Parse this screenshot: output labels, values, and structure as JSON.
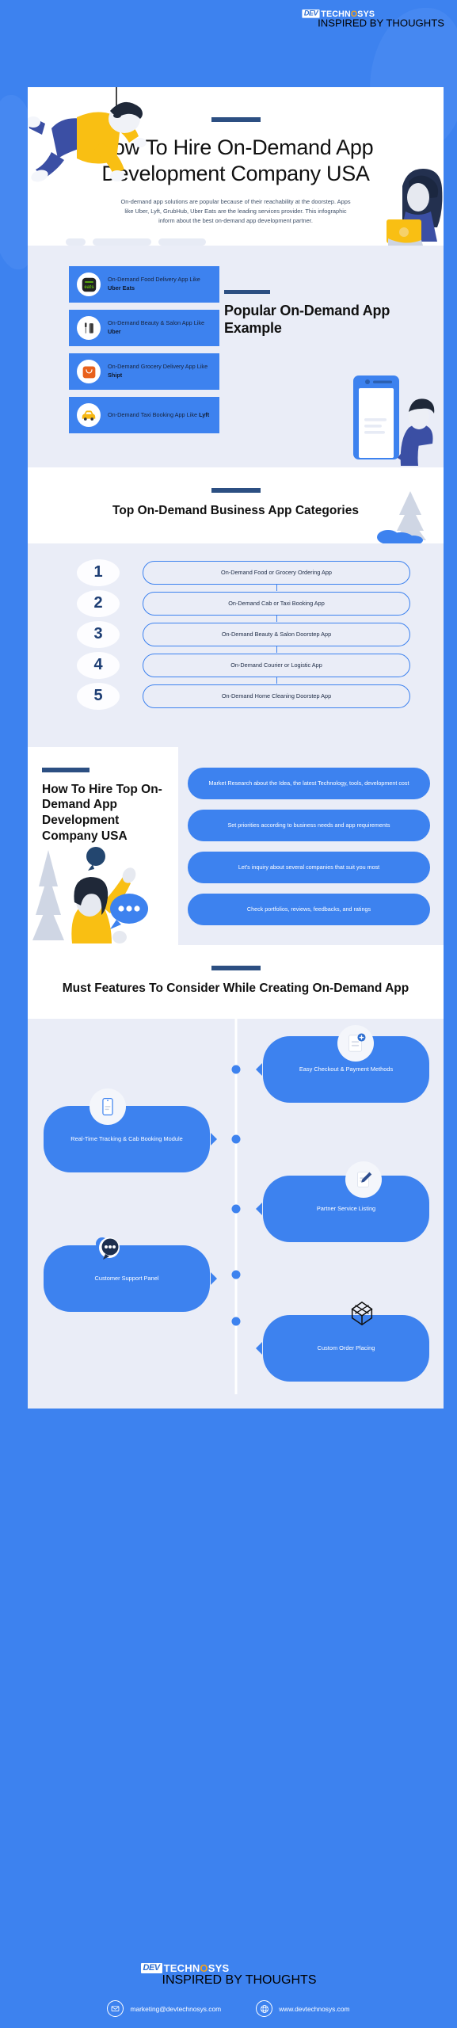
{
  "brand": {
    "name_dev": "DEV",
    "name_tech": "TECHN",
    "name_o": "O",
    "name_sys": "SYS",
    "tagline": "INSPIRED BY THOUGHTS",
    "accent_blue": "#3d82ef",
    "accent_navy": "#2c4f82",
    "accent_orange": "#f2a321",
    "panel_bg": "#eaedf7"
  },
  "hero": {
    "title": "How To Hire On-Demand App Development Company USA",
    "description": "On-demand app solutions are popular because of their reachability at the doorstep. Apps like Uber, Lyft, GrubHub, Uber Eats are the leading services provider. This infographic inform about the best on-demand app development partner."
  },
  "examples": {
    "heading": "Popular On-Demand App Example",
    "cards": [
      {
        "icon": "uber-eats-icon",
        "text_lead": "On-Demand Food Delivery App Like ",
        "text_bold": "Uber Eats"
      },
      {
        "icon": "beauty-salon-icon",
        "text_lead": "On-Demand Beauty & Salon App Like ",
        "text_bold": "Uber"
      },
      {
        "icon": "grocery-bag-icon",
        "text_lead": "On-Demand Grocery Delivery App Like ",
        "text_bold": "Shipt"
      },
      {
        "icon": "taxi-car-icon",
        "text_lead": "On-Demand Taxi Booking App Like ",
        "text_bold": "Lyft"
      }
    ]
  },
  "categories": {
    "heading": "Top On-Demand Business App Categories",
    "items": [
      {
        "number": "1",
        "label": "On-Demand Food or Grocery Ordering App"
      },
      {
        "number": "2",
        "label": "On-Demand Cab or Taxi Booking App"
      },
      {
        "number": "3",
        "label": "On-Demand Beauty & Salon Doorstep App"
      },
      {
        "number": "4",
        "label": "On-Demand Courier or Logistic App"
      },
      {
        "number": "5",
        "label": "On-Demand Home Cleaning Doorstep App"
      }
    ]
  },
  "hire": {
    "heading": "How To Hire Top On-Demand App Development Company USA",
    "steps": [
      "Market Research about the Idea, the latest Technology, tools, development cost",
      "Set priorities according to business needs and app requirements",
      "Let's inquiry about several companies that suit you most",
      "Check portfolios, reviews, feedbacks, and ratings"
    ]
  },
  "features": {
    "heading": "Must Features To Consider While Creating On-Demand App",
    "items": [
      {
        "side": "right",
        "label": "Easy Checkout & Payment Methods",
        "icon": "document-plus-icon"
      },
      {
        "side": "left",
        "label": "Real-Time Tracking & Cab Booking Module",
        "icon": "smartphone-icon"
      },
      {
        "side": "right",
        "label": "Partner Service Listing",
        "icon": "document-pen-icon"
      },
      {
        "side": "left",
        "label": "Customer Support Panel",
        "icon": "chat-bubbles-icon"
      },
      {
        "side": "right",
        "label": "Custom Order Placing",
        "icon": "open-box-icon"
      }
    ]
  },
  "footer": {
    "email": "marketing@devtechnosys.com",
    "website": "www.devtechnosys.com",
    "email_icon": "envelope-icon",
    "web_icon": "globe-icon"
  }
}
